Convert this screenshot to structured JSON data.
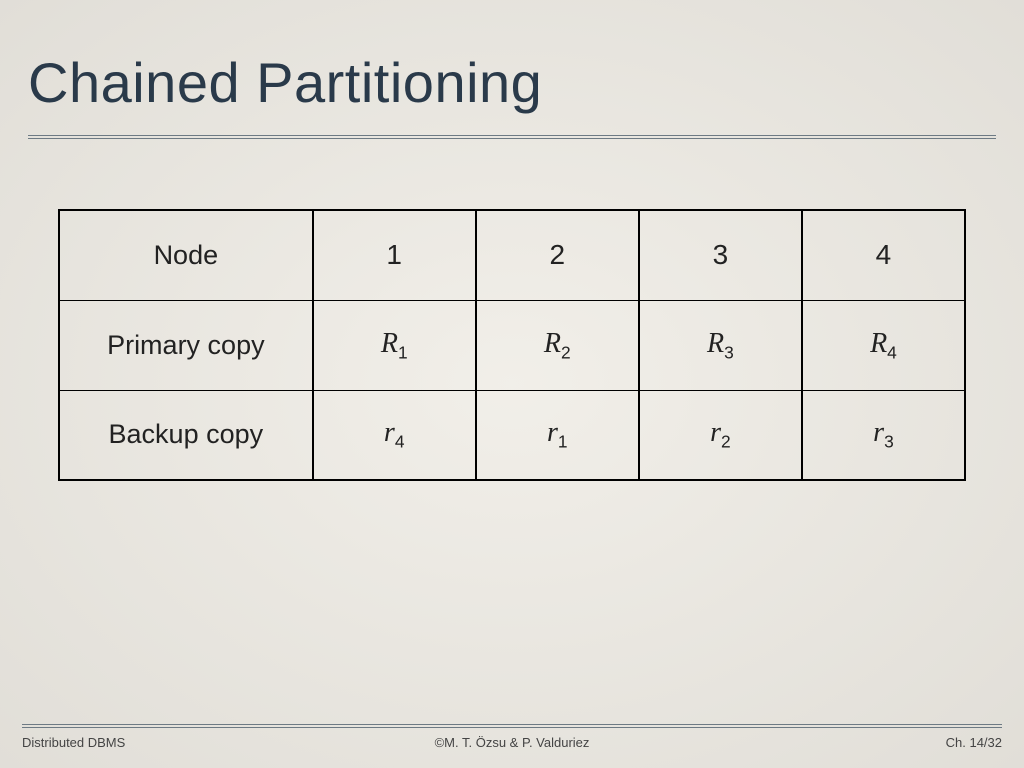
{
  "title": "Chained Partitioning",
  "table": {
    "rows": [
      {
        "label": "Node",
        "cells": [
          "1",
          "2",
          "3",
          "4"
        ]
      },
      {
        "label": "Primary copy",
        "cells": [
          {
            "v": "R",
            "s": "1"
          },
          {
            "v": "R",
            "s": "2"
          },
          {
            "v": "R",
            "s": "3"
          },
          {
            "v": "R",
            "s": "4"
          }
        ]
      },
      {
        "label": "Backup copy",
        "cells": [
          {
            "v": "r",
            "s": "4"
          },
          {
            "v": "r",
            "s": "1"
          },
          {
            "v": "r",
            "s": "2"
          },
          {
            "v": "r",
            "s": "3"
          }
        ]
      }
    ]
  },
  "footer": {
    "left": "Distributed DBMS",
    "center": "©M. T. Özsu & P. Valduriez",
    "right": "Ch. 14/32"
  },
  "chart_data": {
    "type": "table",
    "title": "Chained Partitioning",
    "columns": [
      "Node",
      "1",
      "2",
      "3",
      "4"
    ],
    "rows": [
      [
        "Primary copy",
        "R1",
        "R2",
        "R3",
        "R4"
      ],
      [
        "Backup copy",
        "r4",
        "r1",
        "r2",
        "r3"
      ]
    ]
  }
}
